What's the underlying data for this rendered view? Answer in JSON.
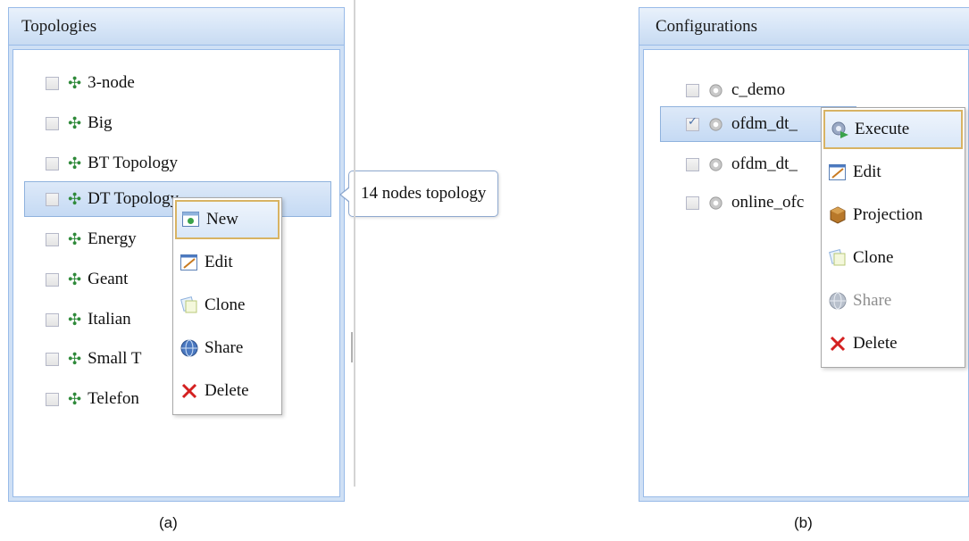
{
  "topologies_panel": {
    "title": "Topologies",
    "items": [
      {
        "label": "3-node",
        "checked": false
      },
      {
        "label": "Big",
        "checked": false
      },
      {
        "label": "BT Topology",
        "checked": false
      },
      {
        "label": "DT Topology",
        "checked": false,
        "selected": true
      },
      {
        "label": "Energy",
        "checked": false
      },
      {
        "label": "Geant",
        "checked": false
      },
      {
        "label": "Italian",
        "checked": false
      },
      {
        "label": "Small T",
        "checked": false
      },
      {
        "label": "Telefon",
        "checked": false
      }
    ],
    "context_menu": {
      "items": [
        {
          "label": "New",
          "icon": "new-icon",
          "active": true
        },
        {
          "label": "Edit",
          "icon": "edit-icon"
        },
        {
          "label": "Clone",
          "icon": "clone-icon"
        },
        {
          "label": "Share",
          "icon": "share-icon"
        },
        {
          "label": "Delete",
          "icon": "delete-icon"
        }
      ]
    },
    "tooltip": "14 nodes topology"
  },
  "configurations_panel": {
    "title": "Configurations",
    "items": [
      {
        "label": "c_demo",
        "checked": false
      },
      {
        "label": "ofdm_dt_",
        "checked": true,
        "selected": true
      },
      {
        "label": "ofdm_dt_",
        "checked": false
      },
      {
        "label": "online_ofc",
        "checked": false
      }
    ],
    "context_menu": {
      "items": [
        {
          "label": "Execute",
          "icon": "execute-icon",
          "active": true
        },
        {
          "label": "Edit",
          "icon": "edit-icon"
        },
        {
          "label": "Projection",
          "icon": "projection-icon"
        },
        {
          "label": "Clone",
          "icon": "clone-icon"
        },
        {
          "label": "Share",
          "icon": "share-icon",
          "disabled": true
        },
        {
          "label": "Delete",
          "icon": "delete-icon"
        }
      ]
    }
  },
  "captions": {
    "a": "(a)",
    "b": "(b)"
  },
  "colors": {
    "panel_border": "#99bbe8",
    "selection": "#c5daf4",
    "menu_active_border": "#d8b363",
    "node_icon": "#2f8a3a",
    "delete_icon": "#d42020"
  }
}
